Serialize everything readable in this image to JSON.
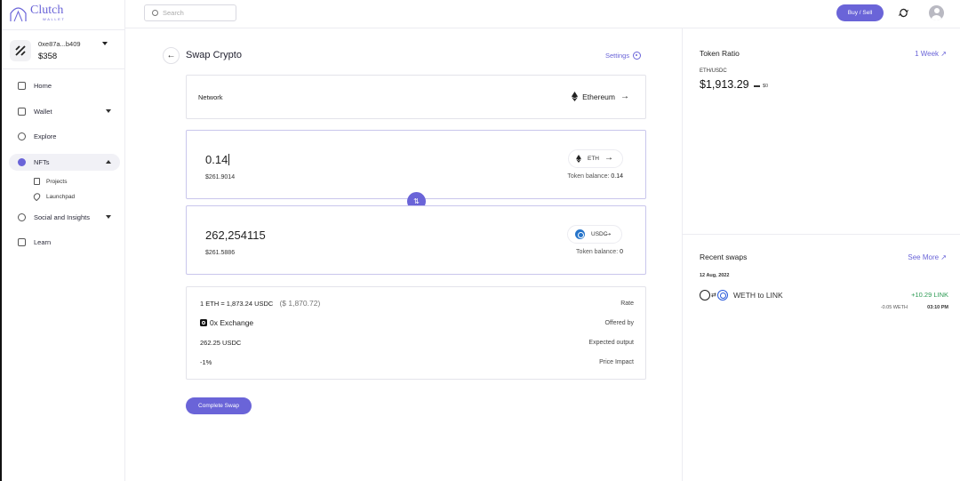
{
  "app": {
    "logo_name": "Clutch",
    "logo_sub": "WALLET"
  },
  "account": {
    "address": "0xe87a...b409",
    "balance": "$358"
  },
  "sidebar": {
    "items": [
      {
        "label": "Home",
        "icon": "home-icon"
      },
      {
        "label": "Wallet",
        "icon": "wallet-icon"
      },
      {
        "label": "Explore",
        "icon": "compass-icon"
      },
      {
        "label": "NFTs",
        "icon": "nft-icon"
      },
      {
        "label": "Social and Insights",
        "icon": "social-icon"
      },
      {
        "label": "Learn",
        "icon": "book-icon"
      }
    ],
    "nft_sub": [
      {
        "label": "Projects",
        "icon": "document-icon"
      },
      {
        "label": "Launchpad",
        "icon": "rocket-icon"
      }
    ]
  },
  "header": {
    "search_placeholder": "Search",
    "buy_sell": "Buy / Sell"
  },
  "main": {
    "title": "Swap Crypto",
    "settings": "Settings",
    "network_label": "Network",
    "network_value": "Ethereum",
    "from": {
      "amount": "0.14",
      "fiat": "$261.9014",
      "token": "ETH",
      "balance_label": "Token balance:",
      "balance_value": "0.14"
    },
    "to": {
      "amount": "262,254115",
      "fiat": "$261.5886",
      "token": "USDC",
      "balance_label": "Token balance:",
      "balance_value": "0"
    },
    "details": {
      "rate_value": "1 ETH = 1,873.24 USDC",
      "rate_fiat": "($ 1,870.72)",
      "rate_label": "Rate",
      "exchange": "0x Exchange",
      "exchange_label": "Offered by",
      "output": "262.25 USDC",
      "output_label": "Expected output",
      "impact": "-1%",
      "impact_label": "Price Impact"
    },
    "complete": "Complete Swap"
  },
  "right": {
    "ratio_title": "Token Ratio",
    "period": "1 Week",
    "pair": "ETH/USDC",
    "price": "$1,913.29",
    "change": "$0",
    "recent_title": "Recent swaps",
    "see_more": "See More",
    "date": "12 Aug, 2022",
    "swap": {
      "description": "WETH to LINK",
      "gain": "+10.29 LINK",
      "loss": "-0.05 WETH",
      "time": "03:10 PM"
    }
  },
  "colors": {
    "accent": "#6a64d8",
    "positive": "#2e9b55",
    "card_border_active": "#c9c6ec"
  }
}
